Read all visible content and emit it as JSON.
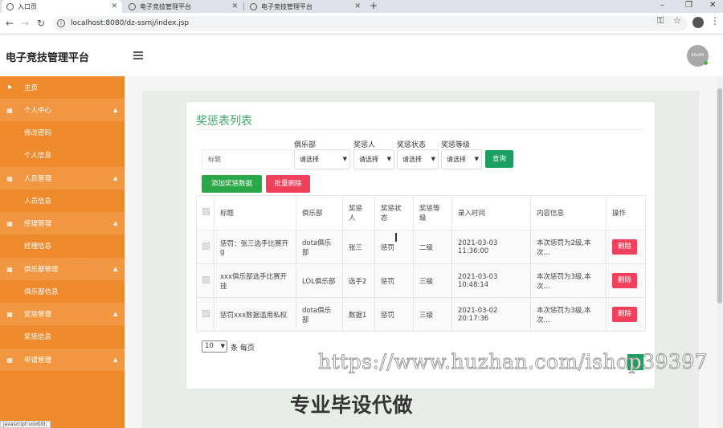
{
  "browser": {
    "tabs": [
      {
        "title": "入口页"
      },
      {
        "title": "电子竞技管理平台"
      },
      {
        "title": "电子竞技管理平台"
      }
    ],
    "new_tab_label": "+",
    "url": "localhost:8080/dz-ssmj/index.jsp",
    "status_url": "javascript:void(0);"
  },
  "header": {
    "title": "电子竞技管理平台",
    "avatar_text": "60x60"
  },
  "sidebar": {
    "home": "主页",
    "groups": [
      {
        "label": "个人中心",
        "items": [
          "修改密码",
          "个人信息"
        ]
      },
      {
        "label": "人员管理",
        "items": [
          "人员信息"
        ]
      },
      {
        "label": "经理管理",
        "items": [
          "经理信息"
        ]
      },
      {
        "label": "俱乐部管理",
        "items": [
          "俱乐部信息"
        ]
      },
      {
        "label": "奖惩管理",
        "items": [
          "奖惩信息"
        ]
      },
      {
        "label": "申请管理",
        "items": []
      }
    ]
  },
  "page": {
    "title": "奖惩表列表",
    "filters": {
      "title_placeholder": "标题",
      "club_label": "俱乐部",
      "person_label": "奖惩人",
      "status_label": "奖惩状态",
      "level_label": "奖惩等级",
      "select_default": "请选择",
      "search_button": "查询"
    },
    "actions": {
      "add": "添加奖惩数据",
      "batch_delete": "批量删除"
    },
    "table": {
      "columns": [
        "标题",
        "俱乐部",
        "奖惩人",
        "奖惩状态",
        "奖惩等级",
        "录入时间",
        "内容信息",
        "操作"
      ],
      "rows": [
        {
          "title": "惩罚：张三选手比赛开g",
          "club": "dota俱乐部",
          "person": "张三",
          "status": "惩罚",
          "level": "二级",
          "time": "2021-03-03 11:36:00",
          "content": "本次惩罚为2级,本次..."
        },
        {
          "title": "xxx俱乐部选手比赛开挂",
          "club": "LOL俱乐部",
          "person": "选手2",
          "status": "惩罚",
          "level": "三级",
          "time": "2021-03-03 10:48:14",
          "content": "本次惩罚为3级,本次..."
        },
        {
          "title": "惩罚xxx数据滥用私权",
          "club": "dota俱乐部",
          "person": "数据1",
          "status": "惩罚",
          "level": "三级",
          "time": "2021-03-02 20:17:36",
          "content": "本次惩罚为3级,本次..."
        }
      ],
      "delete_label": "删除"
    },
    "pager": {
      "page_size": "10",
      "per_page_label": "条 每页"
    }
  },
  "watermark": {
    "url_text": "https://www.huzhan.com/ishop39397",
    "cn_text": "专业毕设代做"
  }
}
